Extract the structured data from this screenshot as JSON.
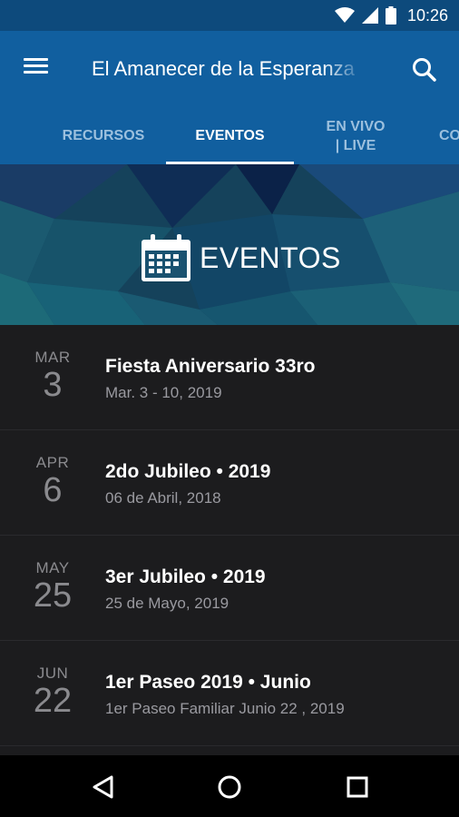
{
  "status_bar": {
    "time": "10:26",
    "icons": [
      "wifi-icon",
      "signal-icon",
      "battery-icon"
    ]
  },
  "app_bar": {
    "title": "El Amanecer de la Esperanza",
    "menu_icon": "hamburger-menu-icon",
    "search_icon": "search-icon"
  },
  "tabs": [
    {
      "label": "RECURSOS",
      "active": false
    },
    {
      "label": "EVENTOS",
      "active": true
    },
    {
      "label": "EN VIVO\n| LIVE",
      "active": false
    },
    {
      "label": "CO",
      "active": false
    }
  ],
  "banner": {
    "title": "EVENTOS",
    "icon": "calendar-icon"
  },
  "events": [
    {
      "month": "MAR",
      "day": "3",
      "title": "Fiesta Aniversario 33ro",
      "subtitle": "Mar. 3 - 10, 2019"
    },
    {
      "month": "APR",
      "day": "6",
      "title": "2do Jubileo • 2019",
      "subtitle": "06 de Abril, 2018"
    },
    {
      "month": "MAY",
      "day": "25",
      "title": "3er Jubileo • 2019",
      "subtitle": "25 de Mayo, 2019"
    },
    {
      "month": "JUN",
      "day": "22",
      "title": "1er Paseo 2019 • Junio",
      "subtitle": "1er Paseo Familiar Junio 22 , 2019"
    }
  ],
  "nav_bar": {
    "buttons": [
      "back-icon",
      "home-icon",
      "recents-icon"
    ]
  },
  "colors": {
    "status_bar": "#0d4a7c",
    "app_bar": "#115f9f",
    "list_bg": "#1c1c1e",
    "tab_inactive": "#9cc0de"
  }
}
